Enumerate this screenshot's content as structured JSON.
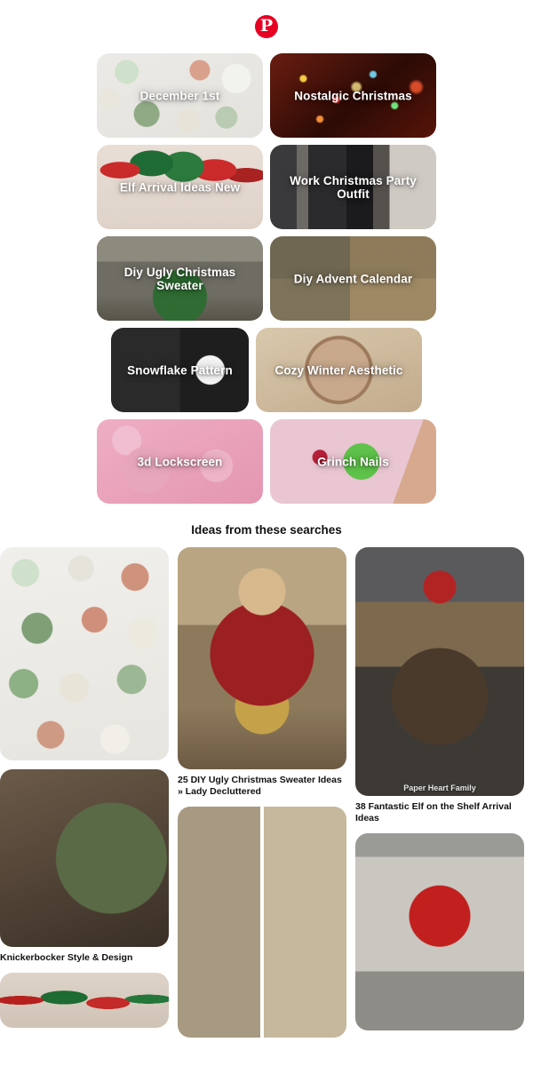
{
  "header": {
    "logo_icon": "pinterest-logo-icon",
    "logo_glyph": "P",
    "brand_color": "#e60023"
  },
  "tile_grid": {
    "rows": [
      [
        {
          "label": "December 1st",
          "art": "art-cookies",
          "size": "w-lg"
        },
        {
          "label": "Nostalgic Christmas",
          "art": "art-lights",
          "size": "w-lg"
        }
      ],
      [
        {
          "label": "Elf Arrival Ideas New",
          "art": "art-balloons",
          "size": "w-lg"
        },
        {
          "label": "Work Christmas Party Outfit",
          "art": "art-outfit",
          "size": "w-lg"
        }
      ],
      [
        {
          "label": "Diy Ugly Christmas Sweater",
          "art": "art-sweater",
          "size": "w-lg"
        },
        {
          "label": "Diy Advent Calendar",
          "art": "art-advent",
          "size": "w-lg"
        }
      ],
      [
        {
          "label": "Snowflake Pattern",
          "art": "art-snowflake",
          "size": "w-sm"
        },
        {
          "label": "Cozy Winter Aesthetic",
          "art": "art-cocoa",
          "size": "w-lg"
        }
      ],
      [
        {
          "label": "3d Lockscreen",
          "art": "art-hearts",
          "size": "w-lg"
        },
        {
          "label": "Grinch Nails",
          "art": "art-grinch",
          "size": "w-lg"
        }
      ]
    ]
  },
  "section": {
    "title": "Ideas from these searches"
  },
  "feed": {
    "columns": [
      {
        "pins": [
          {
            "photo": "ph-cookiewall",
            "title": "",
            "watermark": ""
          },
          {
            "photo": "ph-tree",
            "title": "Knickerbocker Style & Design",
            "watermark": ""
          },
          {
            "photo": "ph-balloons2",
            "title": "",
            "watermark": ""
          }
        ]
      },
      {
        "pins": [
          {
            "photo": "ph-uglysweater",
            "title": "25 DIY Ugly Christmas Sweater Ideas » Lady Decluttered",
            "watermark": ""
          },
          {
            "photo": "ph-rolls",
            "title": "",
            "watermark": ""
          }
        ]
      },
      {
        "pins": [
          {
            "photo": "ph-elf",
            "title": "38 Fantastic Elf on the Shelf Arrival Ideas",
            "watermark": "Paper Heart Family"
          },
          {
            "photo": "ph-bowsweater",
            "title": "",
            "watermark": ""
          }
        ]
      }
    ]
  }
}
